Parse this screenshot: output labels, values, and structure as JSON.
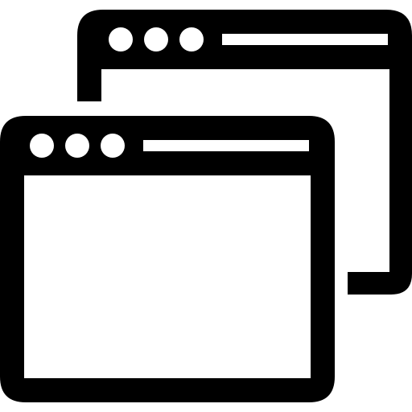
{
  "icon": {
    "name": "multiple-windows-icon",
    "stroke_color": "#000000",
    "fill_color": "#ffffff"
  },
  "windows": [
    {
      "name": "back-window",
      "control_dots": 3,
      "has_title_bar": true
    },
    {
      "name": "front-window",
      "control_dots": 3,
      "has_title_bar": true
    }
  ]
}
